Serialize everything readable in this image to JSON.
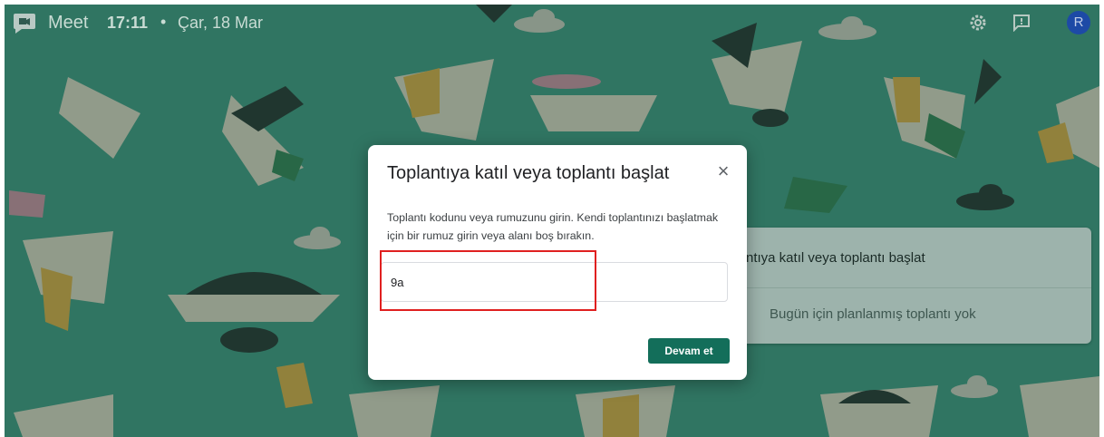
{
  "topbar": {
    "app_name": "Meet",
    "time": "17:11",
    "separator": "•",
    "date": "Çar, 18 Mar",
    "avatar_letter": "R",
    "icons": [
      "meet-logo-icon",
      "gear-icon",
      "feedback-icon"
    ]
  },
  "background_card": {
    "join_label": "ntıya katıl veya toplantı başlat",
    "no_meetings": "Bugün için planlanmış toplantı yok"
  },
  "dialog": {
    "title": "Toplantıya katıl veya toplantı başlat",
    "close_glyph": "×",
    "description": "Toplantı kodunu veya rumuzunu girin. Kendi toplantınızı başlatmak için bir rumuz girin veya alanı boş bırakın.",
    "code_value": "9a",
    "continue_label": "Devam et"
  },
  "colors": {
    "background": "#3a9079",
    "accent_button": "#136e5a",
    "highlight": "#e02020",
    "avatar": "#1d4aa6"
  }
}
